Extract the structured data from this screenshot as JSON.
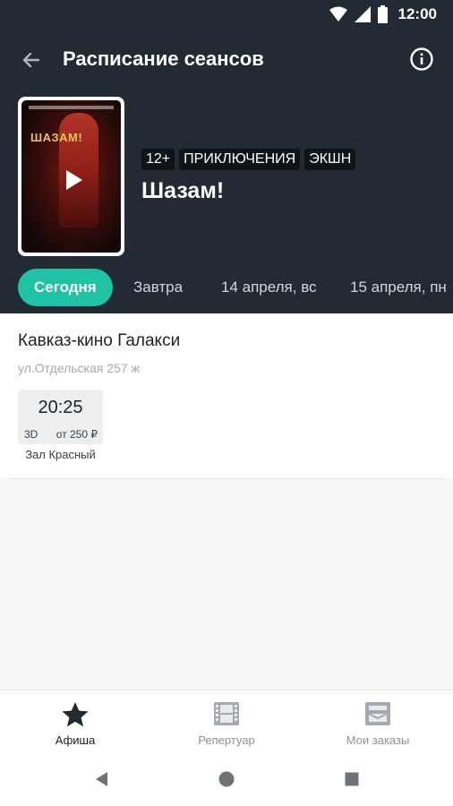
{
  "status": {
    "time": "12:00"
  },
  "toolbar": {
    "title": "Расписание сеансов"
  },
  "movie": {
    "poster_title": "ШАЗАМ!",
    "tags": [
      "12+",
      "ПРИКЛЮЧЕНИЯ",
      "ЭКШН"
    ],
    "title": "Шазам!"
  },
  "date_tabs": [
    {
      "label": "Сегодня",
      "active": true
    },
    {
      "label": "Завтра",
      "active": false
    },
    {
      "label": "14 апреля, вс",
      "active": false
    },
    {
      "label": "15 апреля, пн",
      "active": false
    }
  ],
  "cinema": {
    "name": "Кавказ-кино Галакси",
    "address": "ул.Отдельская 257 ж",
    "sessions": [
      {
        "time": "20:25",
        "format": "3D",
        "price": "от 250 ₽",
        "hall": "Зал Красный"
      }
    ]
  },
  "bottom_nav": [
    {
      "label": "Афиша",
      "icon": "star-icon",
      "active": true
    },
    {
      "label": "Репертуар",
      "icon": "film-icon",
      "active": false
    },
    {
      "label": "Мои заказы",
      "icon": "tickets-icon",
      "active": false
    }
  ],
  "colors": {
    "header_bg": "#222b33",
    "accent": "#20c2a6"
  }
}
